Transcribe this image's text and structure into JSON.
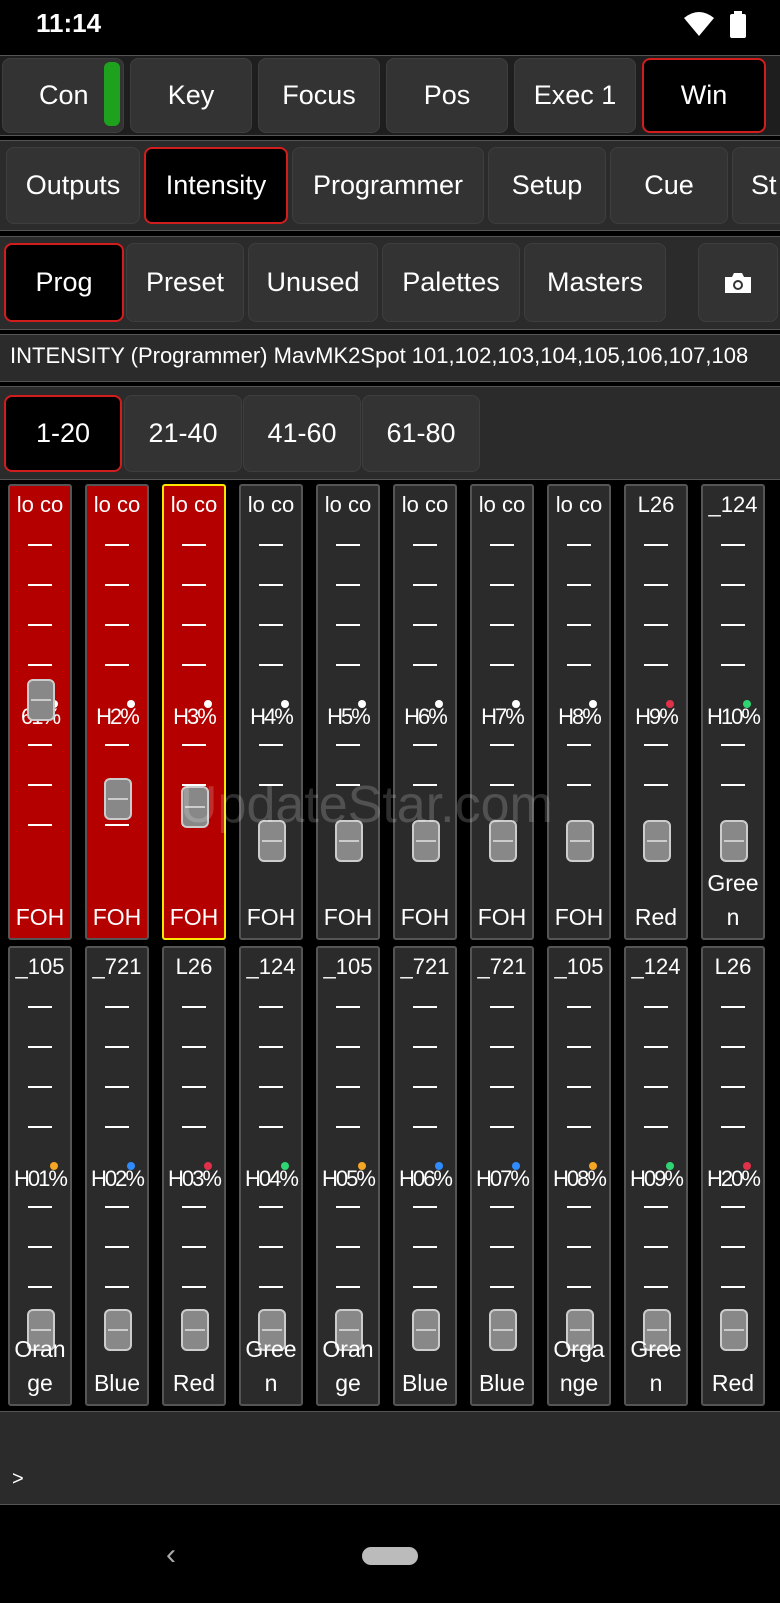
{
  "status": {
    "time": "11:14"
  },
  "tabs_row1": [
    "Con",
    "Key",
    "Focus",
    "Pos",
    "Exec 1",
    "Win"
  ],
  "tabs_row2": [
    "Outputs",
    "Intensity",
    "Programmer",
    "Setup",
    "Cue",
    "St"
  ],
  "tabs_row3": [
    "Prog",
    "Preset",
    "Unused",
    "Palettes",
    "Masters"
  ],
  "info": "INTENSITY (Programmer) MavMK2Spot 101,102,103,104,105,106,107,108",
  "pages": [
    "1-20",
    "21-40",
    "41-60",
    "61-80"
  ],
  "faders_top": [
    {
      "top": "lo co",
      "val": "61%",
      "label": "FOH",
      "level": 0.68,
      "red": true,
      "dot": "#ffffff"
    },
    {
      "top": "lo co",
      "val": "H2%",
      "label": "FOH",
      "level": 0.3,
      "red": true,
      "dot": "#ffffff"
    },
    {
      "top": "lo co",
      "val": "H3%",
      "label": "FOH",
      "level": 0.27,
      "red": true,
      "selected": true,
      "dot": "#ffffff"
    },
    {
      "top": "lo co",
      "val": "H4%",
      "label": "FOH",
      "level": 0.14,
      "dot": "#ffffff"
    },
    {
      "top": "lo co",
      "val": "H5%",
      "label": "FOH",
      "level": 0.14,
      "dot": "#ffffff"
    },
    {
      "top": "lo co",
      "val": "H6%",
      "label": "FOH",
      "level": 0.14,
      "dot": "#ffffff"
    },
    {
      "top": "lo co",
      "val": "H7%",
      "label": "FOH",
      "level": 0.14,
      "dot": "#ffffff"
    },
    {
      "top": "lo co",
      "val": "H8%",
      "label": "FOH",
      "level": 0.14,
      "dot": "#ffffff"
    },
    {
      "top": "L26",
      "val": "H9%",
      "label": "Red",
      "level": 0.14,
      "dot": "#e0304a"
    },
    {
      "top": "_124",
      "val": "H10%",
      "label": "Gree\nn",
      "level": 0.14,
      "dot": "#2ed573"
    }
  ],
  "faders_bottom": [
    {
      "top": "_105",
      "val": "H01%",
      "label": "Oran\nge",
      "level": 0.04,
      "dot": "#f5a623"
    },
    {
      "top": "_721",
      "val": "H02%",
      "label": "Blue",
      "level": 0.04,
      "dot": "#2f8cff"
    },
    {
      "top": "L26",
      "val": "H03%",
      "label": "Red",
      "level": 0.04,
      "dot": "#e0304a"
    },
    {
      "top": "_124",
      "val": "H04%",
      "label": "Gree\nn",
      "level": 0.04,
      "dot": "#2ed573"
    },
    {
      "top": "_105",
      "val": "H05%",
      "label": "Oran\nge",
      "level": 0.04,
      "dot": "#f5a623"
    },
    {
      "top": "_721",
      "val": "H06%",
      "label": "Blue",
      "level": 0.04,
      "dot": "#2f8cff"
    },
    {
      "top": "_721",
      "val": "H07%",
      "label": "Blue",
      "level": 0.04,
      "dot": "#2f8cff"
    },
    {
      "top": "_105",
      "val": "H08%",
      "label": "Orga\nnge",
      "level": 0.04,
      "dot": "#f5a623"
    },
    {
      "top": "_124",
      "val": "H09%",
      "label": "Gree\nn",
      "level": 0.04,
      "dot": "#2ed573"
    },
    {
      "top": "L26",
      "val": "H20%",
      "label": "Red",
      "level": 0.04,
      "dot": "#e0304a"
    }
  ],
  "command": {
    "prompt": ">"
  },
  "watermark": "UpdateStar.com",
  "colors": {
    "accent_red": "#d21d1d",
    "fader_red": "#b50000",
    "select_yellow": "#ffe600",
    "led_green": "#1ea21e"
  }
}
